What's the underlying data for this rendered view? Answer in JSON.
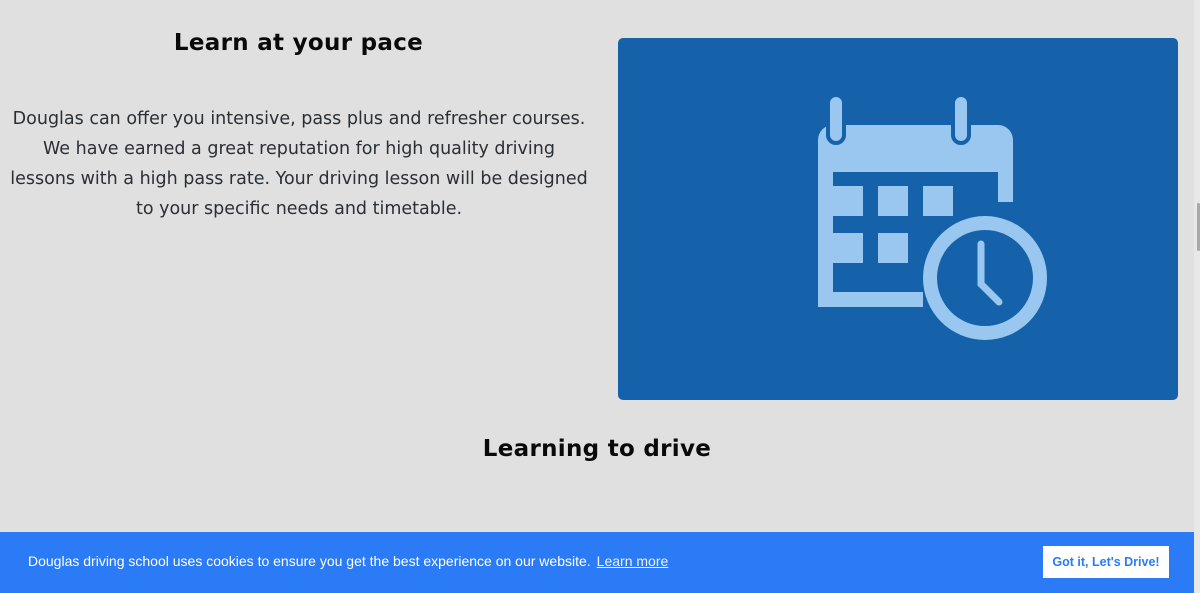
{
  "section_pace": {
    "title": "Learn at your pace",
    "text": "Douglas can offer you intensive, pass plus and refresher courses. We have earned a great reputation for high quality driving lessons with a high pass rate. Your driving lesson will be designed to your specific needs and timetable.",
    "icon": "calendar-clock-icon",
    "panel_color": "#1562ab",
    "icon_color": "#9ac7ef"
  },
  "section_drive": {
    "title": "Learning to drive"
  },
  "cookie_banner": {
    "message": "Douglas driving school uses cookies to ensure you get the best experience on our website.",
    "link_label": "Learn more",
    "button_label": "Got it, Let's Drive!",
    "background_color": "#2a7bf5"
  }
}
